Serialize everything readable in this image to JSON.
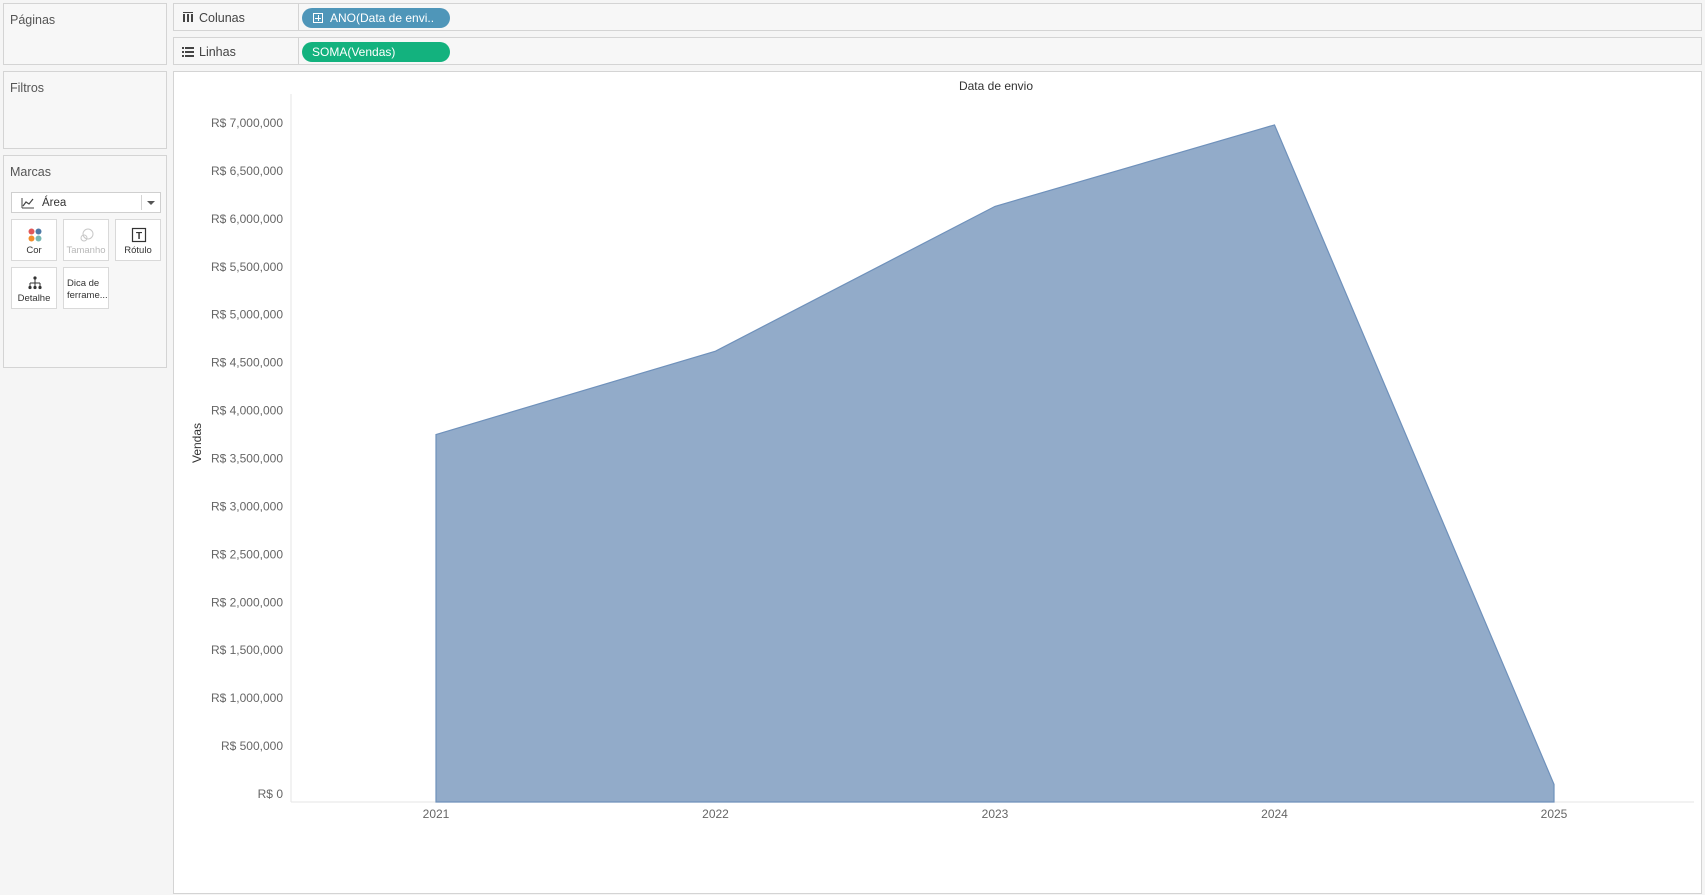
{
  "cards": {
    "pages": "Páginas",
    "filters": "Filtros",
    "marks": "Marcas"
  },
  "marks": {
    "type": "Área",
    "buttons": {
      "color": "Cor",
      "size": "Tamanho",
      "label": "Rótulo",
      "detail": "Detalhe",
      "tooltip": "Dica de\nferrame..."
    }
  },
  "shelves": {
    "columns": {
      "label": "Colunas",
      "pill": "ANO(Data de envi.."
    },
    "rows": {
      "label": "Linhas",
      "pill": "SOMA(Vendas)"
    }
  },
  "colors": {
    "area_fill": "#92abc9",
    "area_stroke": "#6f91bb",
    "columns_pill": "#4f96b9",
    "rows_pill": "#13b27e"
  },
  "chart_data": {
    "type": "area",
    "title": "Data de envio",
    "xlabel": "",
    "ylabel": "Vendas",
    "categories": [
      "2021",
      "2022",
      "2023",
      "2024",
      "2025"
    ],
    "series": [
      {
        "values": [
          3750000,
          4620000,
          6130000,
          6980000,
          100000
        ]
      }
    ],
    "ylim": [
      0,
      7000000
    ],
    "yticks": [
      0,
      500000,
      1000000,
      1500000,
      2000000,
      2500000,
      3000000,
      3500000,
      4000000,
      4500000,
      5000000,
      5500000,
      6000000,
      6500000,
      7000000
    ],
    "ytick_labels": [
      "R$ 0",
      "R$ 500,000",
      "R$ 1,000,000",
      "R$ 1,500,000",
      "R$ 2,000,000",
      "R$ 2,500,000",
      "R$ 3,000,000",
      "R$ 3,500,000",
      "R$ 4,000,000",
      "R$ 4,500,000",
      "R$ 5,000,000",
      "R$ 5,500,000",
      "R$ 6,000,000",
      "R$ 6,500,000",
      "R$ 7,000,000"
    ],
    "grid": false,
    "legend": "none"
  }
}
